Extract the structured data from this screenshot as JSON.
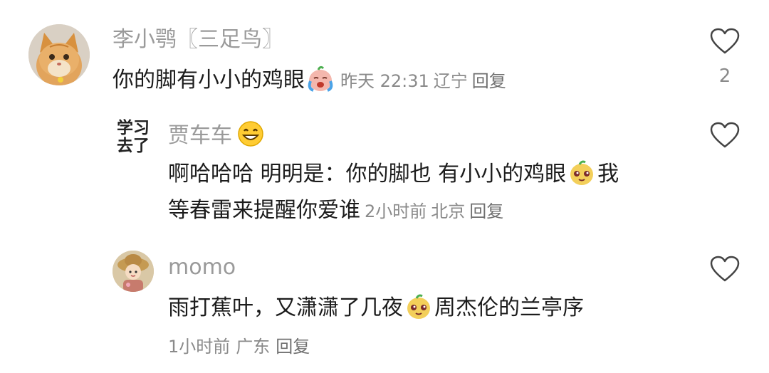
{
  "comments": [
    {
      "user": "李小鹗〖三足鸟〗",
      "text_before": "你的脚有小小的鸡眼",
      "emoji": "crying-face-emoji",
      "time": "昨天 22:31",
      "location": "辽宁",
      "reply": "回复",
      "likes": "2"
    },
    {
      "avatar_text": [
        "学习",
        "去了"
      ],
      "user": "贾车车",
      "user_emoji": "grinning-face-emoji",
      "line1_before": "啊哈哈哈 明明是：你的脚也 有小小的鸡眼",
      "line1_after": "我",
      "line2": "等春雷来提醒你爱谁",
      "emoji": "smug-face-emoji",
      "time": "2小时前",
      "location": "北京",
      "reply": "回复"
    },
    {
      "user": "momo",
      "text_before": "雨打蕉叶，又潇潇了几夜",
      "text_after": "周杰伦的兰亭序",
      "emoji": "smug-face-emoji",
      "time": "1小时前",
      "location": "广东",
      "reply": "回复"
    }
  ],
  "colors": {
    "username": "#9a9a9a",
    "text": "#1c1c1c",
    "meta": "#8a8a8a",
    "heart_stroke": "#444444"
  }
}
